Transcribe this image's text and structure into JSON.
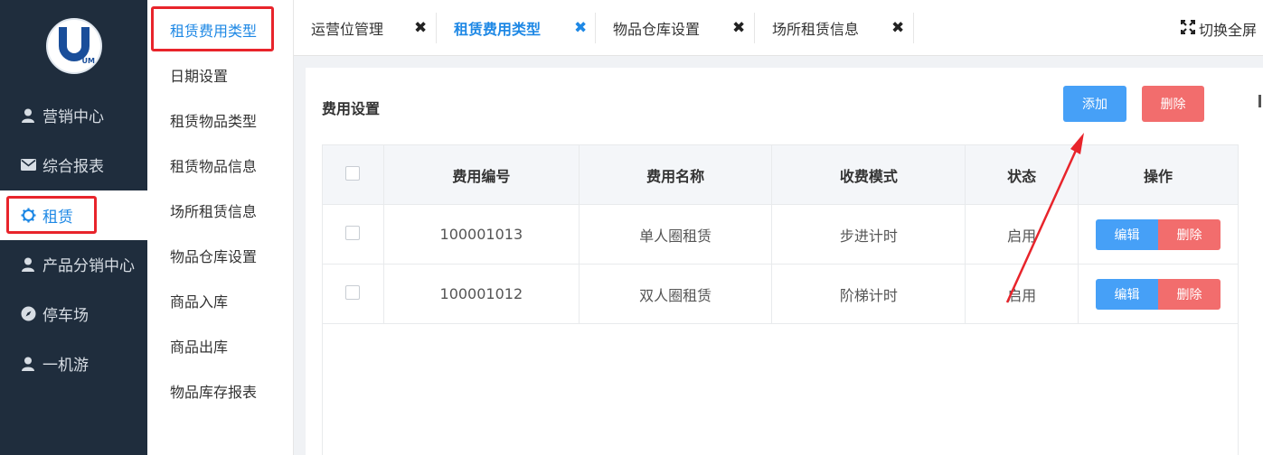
{
  "nav": {
    "logo_text": "UM",
    "items": [
      {
        "label": "营销中心",
        "icon": "user-icon"
      },
      {
        "label": "综合报表",
        "icon": "envelope-icon"
      },
      {
        "label": "租赁",
        "icon": "gear-icon",
        "active": true
      },
      {
        "label": "产品分销中心",
        "icon": "user-icon"
      },
      {
        "label": "停车场",
        "icon": "compass-icon"
      },
      {
        "label": "一机游",
        "icon": "user-icon"
      }
    ]
  },
  "submenu": {
    "items": [
      {
        "label": "租赁费用类型",
        "active": true
      },
      {
        "label": "日期设置"
      },
      {
        "label": "租赁物品类型"
      },
      {
        "label": "租赁物品信息"
      },
      {
        "label": "场所租赁信息"
      },
      {
        "label": "物品仓库设置"
      },
      {
        "label": "商品入库"
      },
      {
        "label": "商品出库"
      },
      {
        "label": "物品库存报表"
      }
    ]
  },
  "tabs": [
    {
      "label": "运营位管理"
    },
    {
      "label": "租赁费用类型",
      "active": true
    },
    {
      "label": "物品仓库设置"
    },
    {
      "label": "场所租赁信息"
    }
  ],
  "fullscreen_label": "切换全屏",
  "panel": {
    "title": "费用设置",
    "add_label": "添加",
    "delete_label": "删除"
  },
  "table": {
    "headers": [
      "费用编号",
      "费用名称",
      "收费模式",
      "状态",
      "操作"
    ],
    "rows": [
      {
        "code": "100001013",
        "name": "单人圈租赁",
        "mode": "步进计时",
        "status": "启用"
      },
      {
        "code": "100001012",
        "name": "双人圈租赁",
        "mode": "阶梯计时",
        "status": "启用"
      }
    ],
    "edit_label": "编辑",
    "remove_label": "删除"
  },
  "colors": {
    "accent": "#1e88e5",
    "annotation": "#e8242b",
    "nav_bg": "#1f2d3d"
  }
}
